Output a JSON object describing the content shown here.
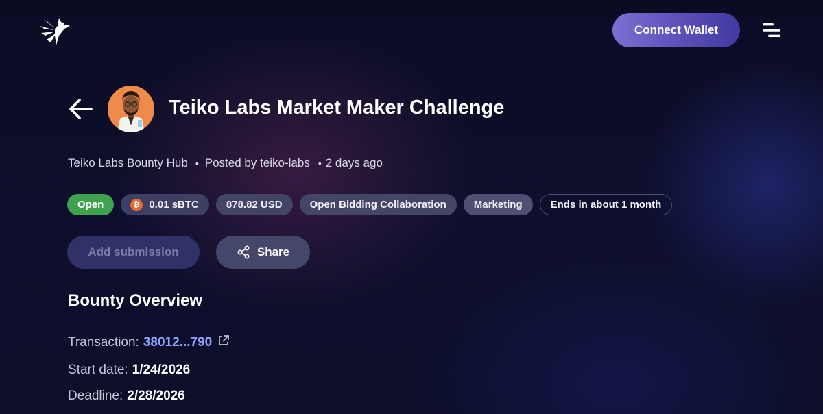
{
  "header": {
    "connect_label": "Connect Wallet",
    "logo_icon": "bird-logo-icon",
    "menu_icon": "hamburger-menu-icon"
  },
  "bounty": {
    "title": "Teiko Labs Market Maker Challenge",
    "hub": "Teiko Labs Bounty Hub",
    "posted_by": "Posted by teiko-labs",
    "posted_ago": "2 days ago",
    "badges": {
      "status": "Open",
      "amount": "0.01 sBTC",
      "usd": "878.82 USD",
      "type": "Open Bidding Collaboration",
      "category": "Marketing",
      "ends": "Ends in about 1 month"
    },
    "actions": {
      "add_submission": "Add submission",
      "share": "Share"
    }
  },
  "overview": {
    "heading": "Bounty Overview",
    "transaction_label": "Transaction:",
    "transaction_value": "38012...790",
    "start_label": "Start date:",
    "start_value": "1/24/2026",
    "deadline_label": "Deadline:",
    "deadline_value": "2/28/2026"
  },
  "colors": {
    "accent": "#6b5fc7",
    "status_open": "#3fa24f",
    "link": "#8ea2ff",
    "btc": "#e96a32",
    "avatar_bg": "#ee8a4a"
  }
}
